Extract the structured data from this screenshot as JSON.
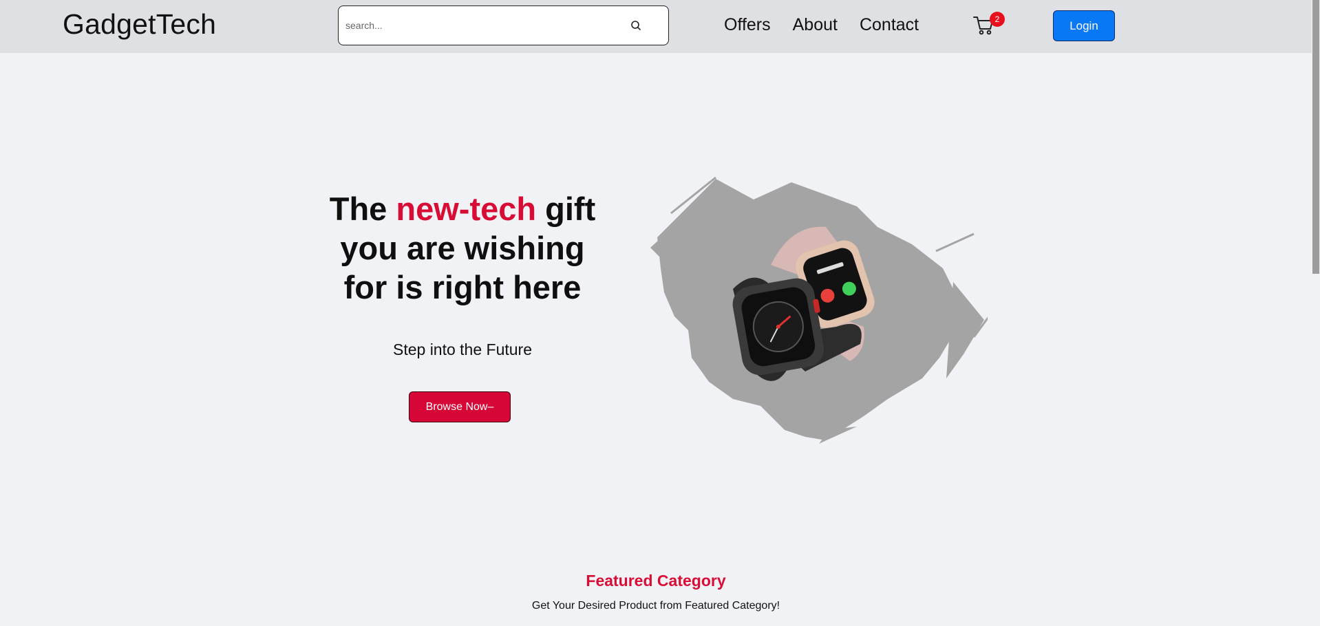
{
  "header": {
    "brand": "GadgetTech",
    "search_placeholder": "search...",
    "nav": [
      "Offers",
      "About",
      "Contact"
    ],
    "cart_count": "2",
    "login_label": "Login"
  },
  "hero": {
    "title_before": "The ",
    "title_accent": "new-tech",
    "title_after": " gift you are wishing for is right here",
    "subtitle": "Step into the Future",
    "button_label": "Browse Now–"
  },
  "featured": {
    "title": "Featured Category",
    "subtitle": "Get Your Desired Product from Featured Category!"
  },
  "colors": {
    "accent": "#d80d36",
    "login_blue": "#0878f5",
    "header_bg": "#dfe0e4",
    "page_bg": "#f1f2f6"
  },
  "icons": [
    "search-icon",
    "cart-icon"
  ],
  "hero_image": "smartwatches-on-gray-brush-stroke"
}
